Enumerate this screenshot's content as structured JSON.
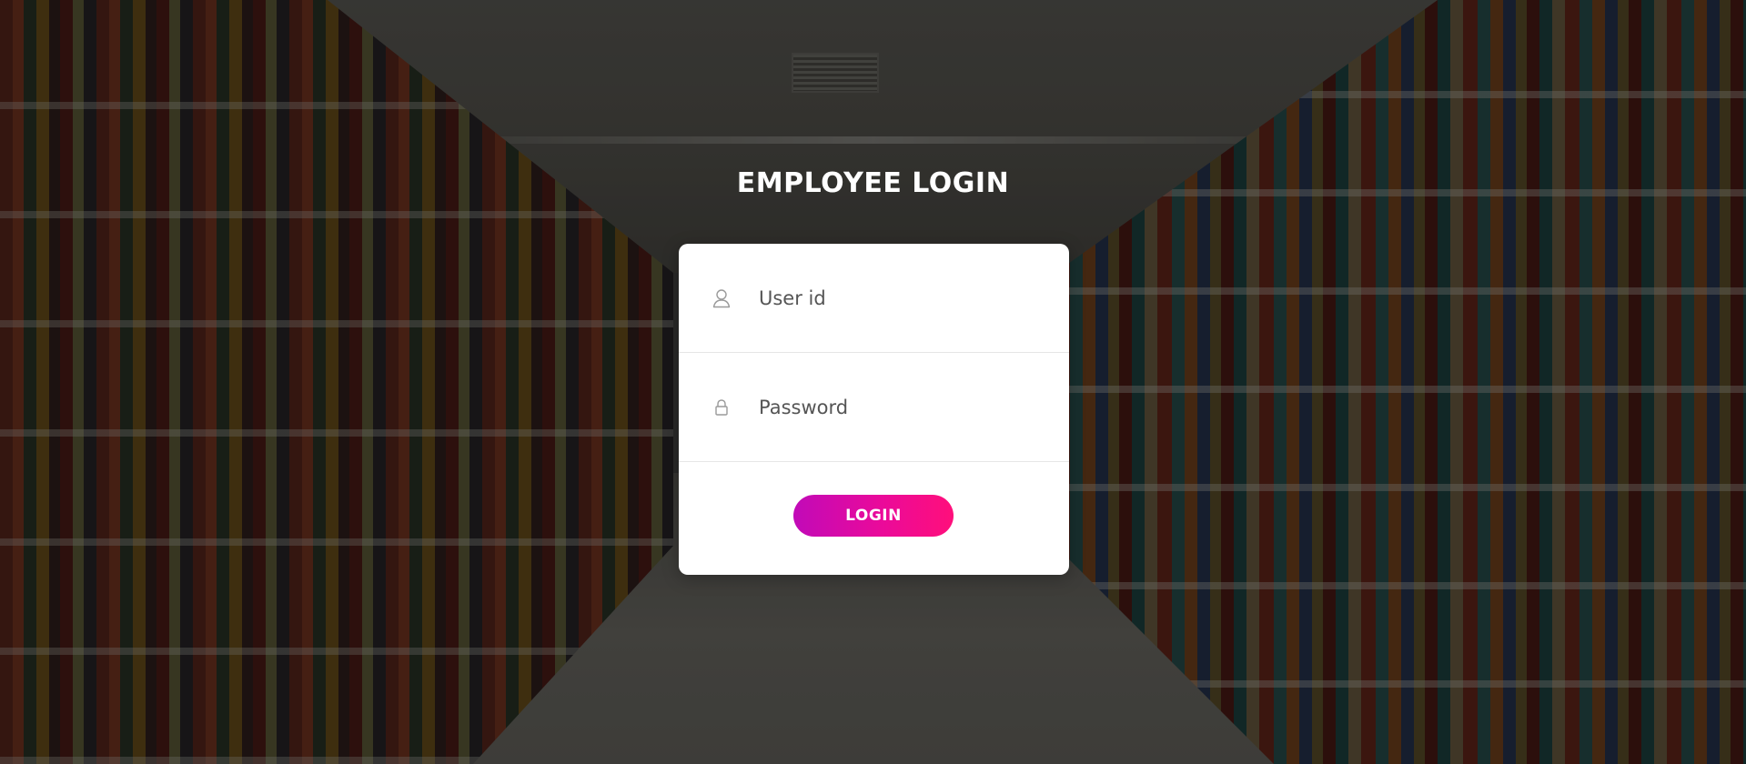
{
  "page": {
    "title": "EMPLOYEE LOGIN"
  },
  "form": {
    "user_id": {
      "placeholder": "User id",
      "value": "",
      "icon": "user-icon"
    },
    "password": {
      "placeholder": "Password",
      "value": "",
      "icon": "lock-icon"
    },
    "login_label": "LOGIN"
  },
  "colors": {
    "button_gradient_start": "#c10ab8",
    "button_gradient_end": "#ff0f7b",
    "card_background": "#ffffff",
    "title_color": "#ffffff"
  }
}
